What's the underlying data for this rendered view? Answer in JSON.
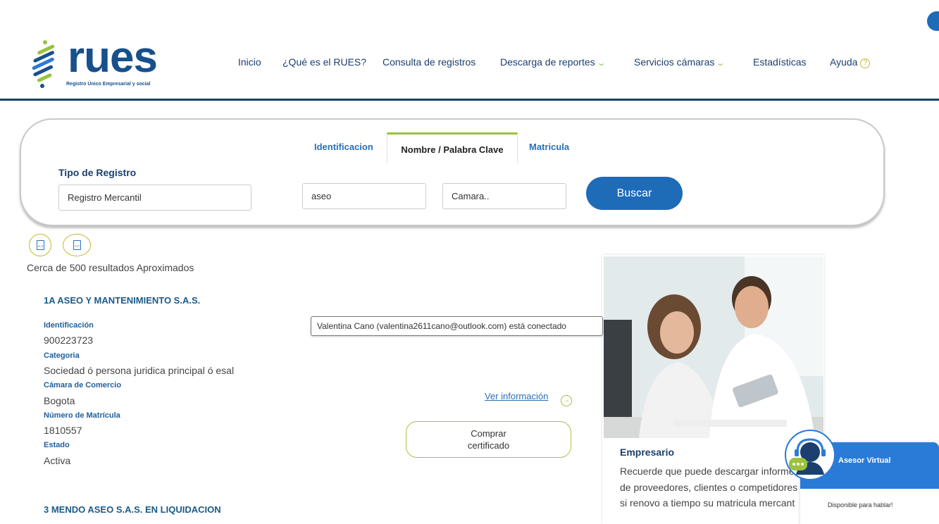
{
  "header": {
    "logo_text": "rues",
    "logo_subtitle": "Registro Único Empresarial y social",
    "nav": [
      {
        "label": "Inicio"
      },
      {
        "label": "¿Qué es el RUES?"
      },
      {
        "label": "Consulta de registros"
      },
      {
        "label": "Descarga de reportes"
      },
      {
        "label": "Servicios cámaras"
      },
      {
        "label": "Estadísticas"
      },
      {
        "label": "Ayuda"
      }
    ]
  },
  "search": {
    "tabs": [
      "Identificacion",
      "Nombre / Palabra Clave",
      "Matricula"
    ],
    "active_tab": "Nombre / Palabra Clave",
    "tipo_label": "Tipo de Registro",
    "tipo_value": "Registro Mercantil",
    "keyword_value": "aseo",
    "camara_placeholder": "Camara..",
    "buscar_label": "Buscar"
  },
  "export": {
    "xls_label": "XLS",
    "txt_label": "TXT"
  },
  "results": {
    "count_text": "Cerca de 500 resultados Aproximados",
    "items": [
      {
        "name": "1A ASEO Y MANTENIMIENTO S.A.S.",
        "identificacion_label": "Identificación",
        "identificacion": "900223723",
        "categoria_label": "Categoria",
        "categoria": "Sociedad ó persona juridica principal ó esal",
        "camara_label": "Cámara de Comercio",
        "camara": "Bogota",
        "matricula_label": "Número de Matrícula",
        "matricula": "1810557",
        "estado_label": "Estado",
        "estado": "Activa",
        "ver_info": "Ver información",
        "comprar_line1": "Comprar",
        "comprar_line2": "certificado"
      },
      {
        "name": "3 MENDO ASEO S.A.S. EN LIQUIDACION"
      }
    ]
  },
  "tooltip": {
    "text": "Valentina Cano (valentina2611cano@outlook.com) está conectado"
  },
  "ad": {
    "title": "Empresario",
    "lines": [
      "Recuerde que puede descargar informes",
      "de proveedores, clientes o competidores",
      "si renovo a tiempo su matricula mercant"
    ]
  },
  "asesor": {
    "title": "Asesor Virtual",
    "status": "Disponible para hablar!"
  },
  "colors": {
    "brand_blue": "#17508c",
    "accent_green": "#9bc23c",
    "button_blue": "#1e6bb8"
  }
}
